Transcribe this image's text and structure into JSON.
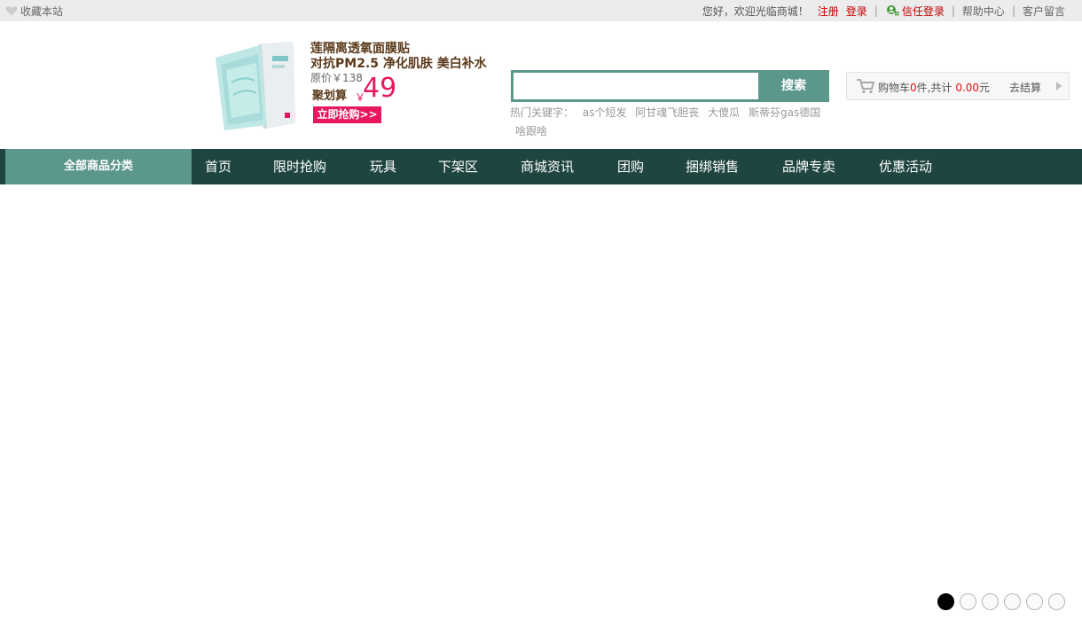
{
  "topbar": {
    "favorite_label": "收藏本站",
    "welcome": "您好，欢迎光临商城！",
    "register": "注册",
    "login": "登录",
    "sep": "|",
    "trust_login": "信任登录",
    "help_center": "帮助中心",
    "customer_message": "客户留言"
  },
  "ad": {
    "line1": "莲隔离透氧面膜贴",
    "line2": "对抗PM2.5 净化肌肤 美白补水",
    "original_price": "原价￥138",
    "ju_label": "聚划算",
    "currency": "￥",
    "price": "49",
    "buy_button": "立即抢购>>"
  },
  "search": {
    "value": "",
    "placeholder": "",
    "button_label": "搜索",
    "hot_label": "热门关键字：",
    "hot_keywords": [
      "as个短发",
      "阿甘魂飞胆丧",
      "大傻瓜",
      "斯蒂芬gas德国",
      "啥跟啥"
    ]
  },
  "cart": {
    "label": "购物车",
    "count": "0",
    "count_unit": "件,共计",
    "total": "0.00",
    "currency_unit": "元",
    "checkout": "去结算"
  },
  "nav": {
    "all_categories": "全部商品分类",
    "items": [
      "首页",
      "限时抢购",
      "玩具",
      "下架区",
      "商城资讯",
      "团购",
      "捆绑销售",
      "品牌专卖",
      "优惠活动"
    ]
  },
  "slider": {
    "slide_count": 6,
    "active_index": 0
  },
  "colors": {
    "accent": "#5b978b",
    "nav_bg": "#1f4540",
    "promo": "#e8185f",
    "link_red": "#c00000"
  }
}
